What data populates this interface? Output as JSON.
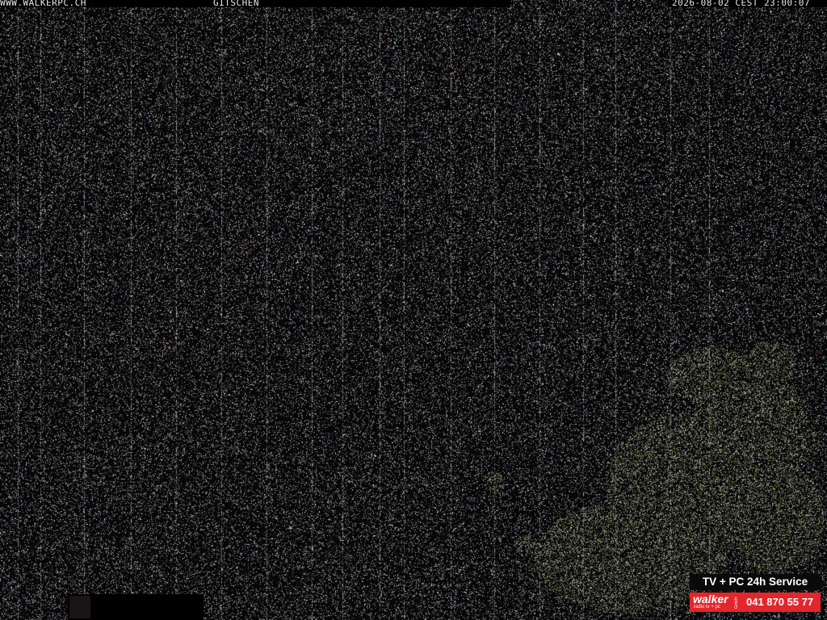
{
  "overlay": {
    "site": "WWW.WALKERPC.CH",
    "location": "GITSCHEN",
    "datetime": "2026-08-02 CEST 23:00:07"
  },
  "advertisement": {
    "tagline": "TV + PC 24h Service",
    "brand": "walker",
    "brand_sub": "radio tv + pc",
    "brand_suffix": "GmbH",
    "phone": "041 870 55 77",
    "colors": {
      "brand_bar": "#e3262b",
      "tagline_bg": "#0a0a0a",
      "text": "#ffffff"
    }
  },
  "scene": {
    "description_type": "night webcam image",
    "colors": {
      "sky": "#070707",
      "noise": "#bdbdbd",
      "foliage": "#9aa86a"
    }
  }
}
